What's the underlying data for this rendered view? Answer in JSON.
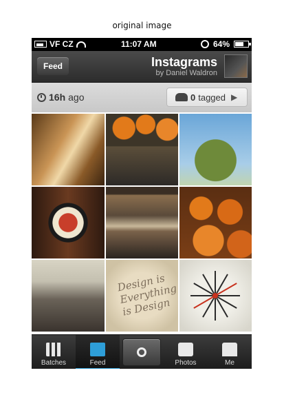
{
  "caption": "original image",
  "status_bar": {
    "carrier": "VF CZ",
    "time": "11:07 AM",
    "battery": "64%"
  },
  "nav": {
    "back_label": "Feed",
    "title": "Instagrams",
    "subtitle": "by Daniel Waldron"
  },
  "meta": {
    "age_value": "16h",
    "age_suffix": "ago",
    "tagged_count": "0",
    "tagged_label": "tagged"
  },
  "photos": [
    {
      "name": "photo-books"
    },
    {
      "name": "photo-pumpkins-feet"
    },
    {
      "name": "photo-tree-sky"
    },
    {
      "name": "photo-framed-poster"
    },
    {
      "name": "photo-shelf"
    },
    {
      "name": "photo-pumpkin-pile"
    },
    {
      "name": "photo-city-fog"
    },
    {
      "name": "photo-design-script",
      "text": "Design is Everything is Design"
    },
    {
      "name": "photo-starburst-clock"
    }
  ],
  "tabs": {
    "batches": "Batches",
    "feed": "Feed",
    "photos": "Photos",
    "me": "Me"
  },
  "colors": {
    "accent": "#2e9ed8",
    "navbar": "#3a3a3a",
    "metabar": "#d4d4d4"
  }
}
